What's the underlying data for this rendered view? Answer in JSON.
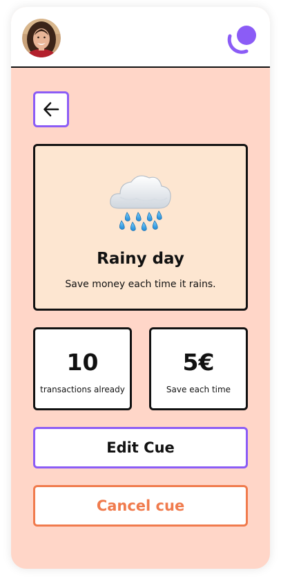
{
  "header": {
    "avatar": "user-avatar-photo",
    "logo": "brand-logo"
  },
  "nav": {
    "back_icon": "arrow-left-icon"
  },
  "cue": {
    "icon": "rain-cloud-icon",
    "title": "Rainy day",
    "description": "Save money each time it rains."
  },
  "stats": [
    {
      "value": "10",
      "label": "transactions already"
    },
    {
      "value": "5€",
      "label": "Save each time"
    }
  ],
  "actions": {
    "edit_label": "Edit Cue",
    "cancel_label": "Cancel cue"
  },
  "colors": {
    "background": "#ffd6c8",
    "card": "#fde6d1",
    "accent_purple": "#8b5cf6",
    "accent_orange": "#f07b4d"
  }
}
